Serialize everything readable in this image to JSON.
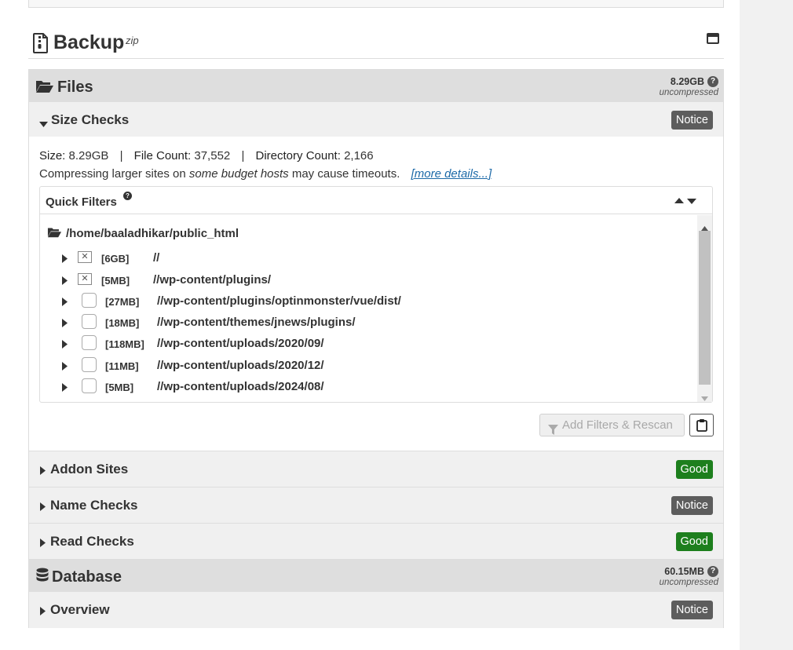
{
  "backup": {
    "title": "Backup",
    "format": "zip"
  },
  "files": {
    "title": "Files",
    "size": "8.29GB",
    "uncompressed": "uncompressed",
    "size_checks": {
      "label": "Size Checks",
      "status": "Notice",
      "size_label": "Size:",
      "size_value": "8.29GB",
      "sep": "|",
      "file_count_label": "File Count:",
      "file_count_value": "37,552",
      "dir_count_label": "Directory Count:",
      "dir_count_value": "2,166",
      "warn_pre": "Compressing larger sites on ",
      "warn_em": "some budget hosts",
      "warn_post": " may cause timeouts.",
      "more_link": "[more details...]"
    },
    "quick_filters": {
      "title": "Quick Filters",
      "root_path": "/home/baaladhikar/public_html",
      "items": [
        {
          "size": "[6GB]",
          "path": "//",
          "excluded": true
        },
        {
          "size": "[5MB]",
          "path": "//wp-content/plugins/",
          "excluded": true
        },
        {
          "size": "[27MB]",
          "path": "//wp-content/plugins/optinmonster/vue/dist/",
          "excluded": false
        },
        {
          "size": "[18MB]",
          "path": "//wp-content/themes/jnews/plugins/",
          "excluded": false
        },
        {
          "size": "[118MB]",
          "path": "//wp-content/uploads/2020/09/",
          "excluded": false
        },
        {
          "size": "[11MB]",
          "path": "//wp-content/uploads/2020/12/",
          "excluded": false
        },
        {
          "size": "[5MB]",
          "path": "//wp-content/uploads/2024/08/",
          "excluded": false
        }
      ],
      "rescan_label": "Add Filters & Rescan"
    },
    "addon_sites": {
      "label": "Addon Sites",
      "status": "Good"
    },
    "name_checks": {
      "label": "Name Checks",
      "status": "Notice"
    },
    "read_checks": {
      "label": "Read Checks",
      "status": "Good"
    }
  },
  "database": {
    "title": "Database",
    "size": "60.15MB",
    "uncompressed": "uncompressed",
    "overview": {
      "label": "Overview",
      "status": "Notice"
    }
  },
  "colors": {
    "notice": "#5d5d5d",
    "good": "#1d7f1d",
    "link": "#1d6aa8",
    "header": "#dedede"
  },
  "icons": [
    "file-zip-icon",
    "archive-icon",
    "folder-open-icon",
    "help-icon",
    "caret-down-icon",
    "caret-right-icon",
    "sort-icon",
    "filter-icon",
    "clipboard-icon",
    "database-icon"
  ]
}
